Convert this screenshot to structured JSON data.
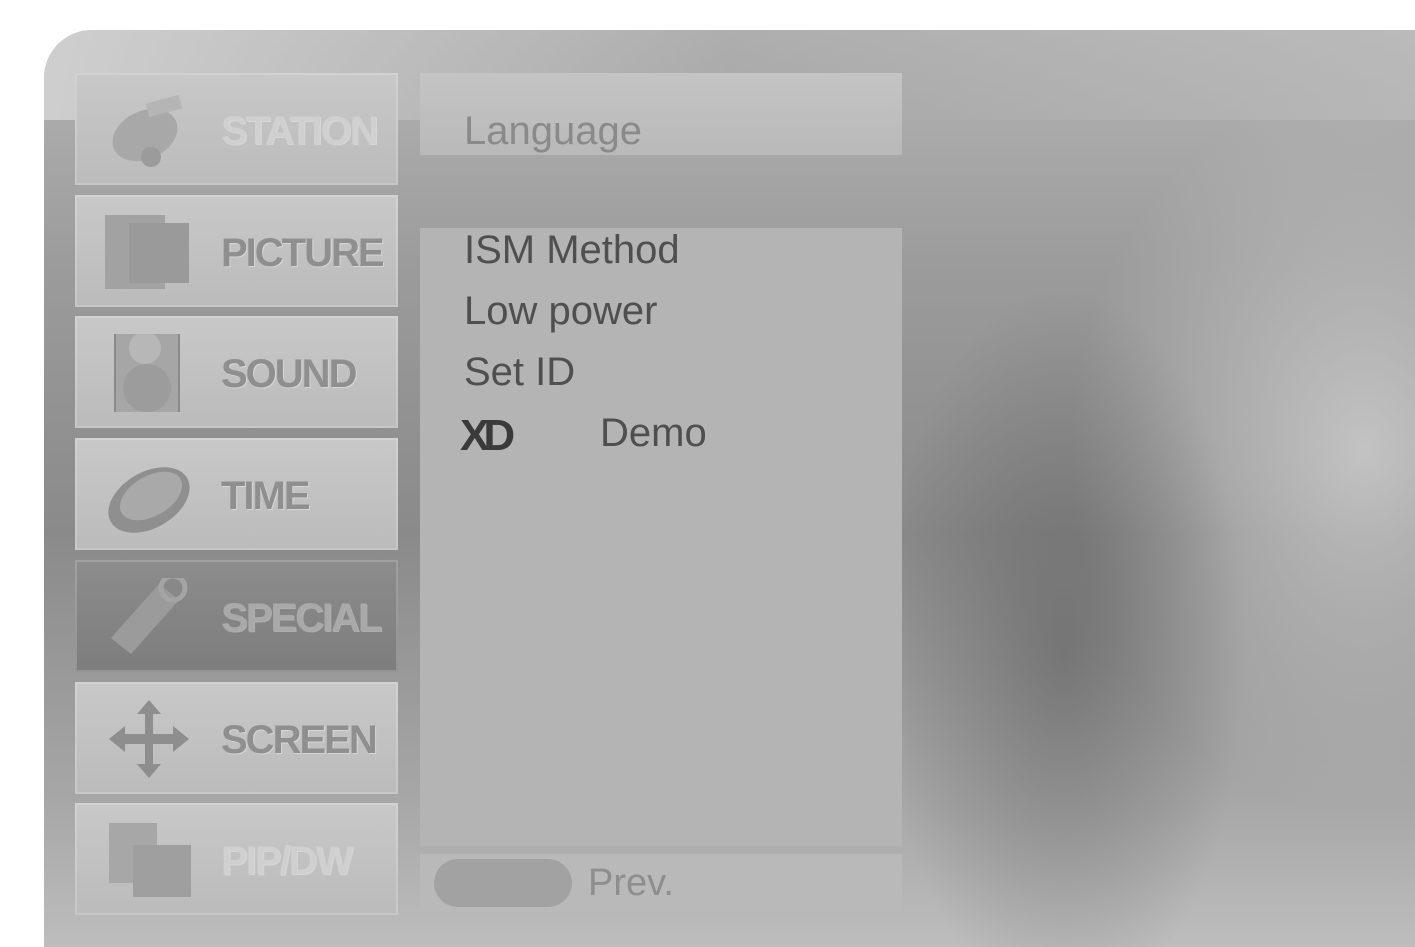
{
  "menu": {
    "items": [
      {
        "label": "STATION",
        "icon": "antenna-icon"
      },
      {
        "label": "PICTURE",
        "icon": "picture-icon"
      },
      {
        "label": "SOUND",
        "icon": "speaker-icon"
      },
      {
        "label": "TIME",
        "icon": "clock-icon"
      },
      {
        "label": "SPECIAL",
        "icon": "tag-icon",
        "selected": true
      },
      {
        "label": "SCREEN",
        "icon": "move-arrows-icon"
      },
      {
        "label": "PIP/DW",
        "icon": "pip-icon"
      }
    ]
  },
  "submenu": {
    "header": "Language",
    "items": [
      "ISM Method",
      "Low power",
      "Set ID",
      "Demo"
    ],
    "demo_logo_text": "XD"
  },
  "footer": {
    "prev_label": "Prev."
  }
}
